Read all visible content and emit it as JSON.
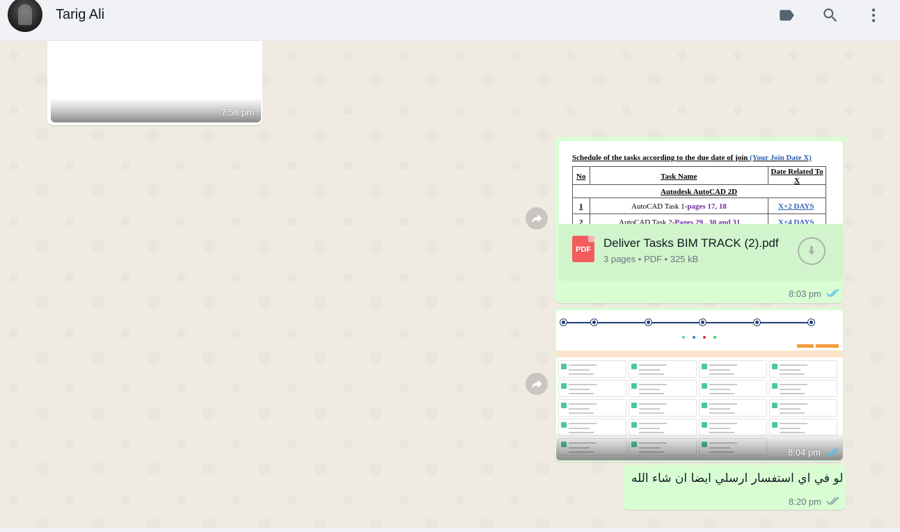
{
  "header": {
    "contact_name": "Tarig Ali"
  },
  "icons": {
    "label": "label-icon",
    "search": "search-icon",
    "menu": "more-vert-icon",
    "forward": "forward-icon",
    "download": "download-icon",
    "ticks": "double-check-icon"
  },
  "colors": {
    "outgoing_bubble": "#d9fdd3",
    "read_ticks": "#53bdeb",
    "delivered_ticks": "#8696a0",
    "pdf_red": "#f15c5c"
  },
  "messages": {
    "incoming_image": {
      "time": "7:58 pm"
    },
    "document": {
      "preview": {
        "title_main": "Schedule of the tasks according to the due date of join",
        "title_blue": "(Your Join Date   X)",
        "col_no": "No",
        "col_task": "Task Name",
        "col_date": "Date Related To X",
        "section": "Autodesk AutoCAD 2D",
        "rows": [
          {
            "no": "1",
            "task_prefix": "AutoCAD Task 1-",
            "task_pages": "pages 17, 18",
            "date": "X+2 DAYS"
          },
          {
            "no": "2",
            "task_prefix": "AutoCAD Task 2-",
            "task_pages": "Pages 29 , 30 and 31",
            "date": "X+4 DAYS"
          }
        ]
      },
      "file_name": "Deliver Tasks BIM TRACK (2).pdf",
      "file_type_label": "PDF",
      "meta": "3 pages • PDF • 325 kB",
      "time": "8:03 pm"
    },
    "screenshot_image": {
      "time": "8:04 pm"
    },
    "text_message": {
      "text": "لو في اي استفسار ارسلي ايضا ان شاء الله",
      "time": "8:20 pm"
    }
  }
}
